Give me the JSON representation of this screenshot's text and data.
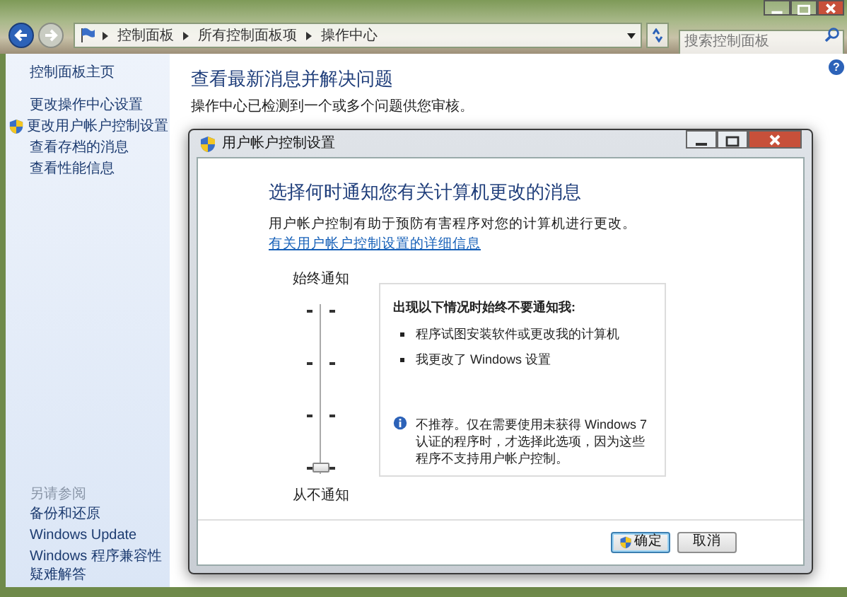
{
  "address_bar": {
    "breadcrumbs": [
      "控制面板",
      "所有控制面板项",
      "操作中心"
    ]
  },
  "search": {
    "placeholder": "搜索控制面板"
  },
  "sidebar": {
    "items": [
      {
        "label": "控制面板主页",
        "kind": "plain"
      },
      {
        "label": "更改操作中心设置",
        "kind": "plain"
      },
      {
        "label": "更改用户帐户控制设置",
        "kind": "shield"
      },
      {
        "label": "查看存档的消息",
        "kind": "plain"
      },
      {
        "label": "查看性能信息",
        "kind": "plain"
      }
    ],
    "see_also": {
      "title": "另请参阅",
      "items": [
        "备份和还原",
        "Windows Update",
        "Windows 程序兼容性疑难解答"
      ]
    }
  },
  "main": {
    "help": "?",
    "heading": "查看最新消息并解决问题",
    "subtitle": "操作中心已检测到一个或多个问题供您审核。"
  },
  "dialog": {
    "title": "用户帐户控制设置",
    "heading": "选择何时通知您有关计算机更改的消息",
    "description": "用户帐户控制有助于预防有害程序对您的计算机进行更改。",
    "link": "有关用户帐户控制设置的详细信息",
    "slider": {
      "top_label": "始终通知",
      "bottom_label": "从不通知",
      "level": 0
    },
    "info_panel": {
      "title": "出现以下情况时始终不要通知我:",
      "bullets": [
        "程序试图安装软件或更改我的计算机",
        "我更改了 Windows 设置"
      ],
      "note": "不推荐。仅在需要使用未获得 Windows 7 认证的程序时，才选择此选项，因为这些程序不支持用户帐户控制。"
    },
    "buttons": [
      {
        "label": "确定",
        "kind": "primary"
      },
      {
        "label": "取消",
        "kind": "normal"
      }
    ]
  }
}
